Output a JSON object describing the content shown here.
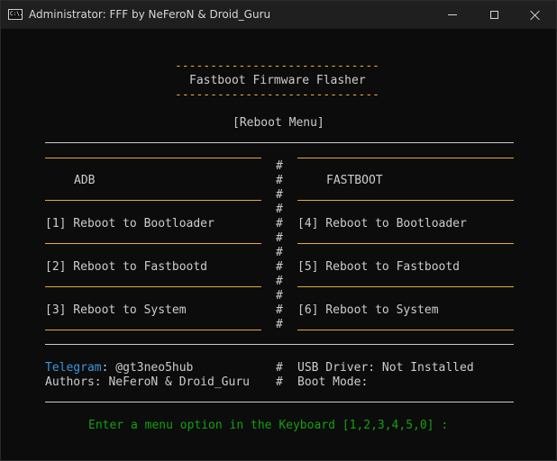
{
  "window": {
    "icon_label": "C:\\.",
    "title": "Administrator:  FFF by NeFeroN & Droid_Guru"
  },
  "console": {
    "header_dashes_top": "-----------------------------",
    "app_title": "Fastboot Firmware Flasher",
    "header_dashes_bottom": "-----------------------------",
    "menu_heading": "[Reboot Menu]",
    "col_left_title": "ADB",
    "col_right_title": "FASTBOOT",
    "hash": "#",
    "left_options": [
      "[1] Reboot to Bootloader",
      "[2] Reboot to Fastbootd",
      "[3] Reboot to System"
    ],
    "right_options": [
      "[4] Reboot to Bootloader",
      "[5] Reboot to Fastbootd",
      "[6] Reboot to System"
    ],
    "telegram_label": "Telegram",
    "telegram_value": ": @gt3neo5hub",
    "authors": "Authors: NeFeroN & Droid_Guru",
    "usb_driver": "USB Driver: Not Installed",
    "boot_mode": "Boot Mode:",
    "prompt": "Enter a menu option in the Keyboard [1,2,3,4,5,0] :"
  },
  "colors": {
    "background": "#0c0c0c",
    "text": "#cccccc",
    "accent_gold": "#e8a838",
    "telegram_blue": "#3a96dd",
    "prompt_green": "#13a10e"
  }
}
